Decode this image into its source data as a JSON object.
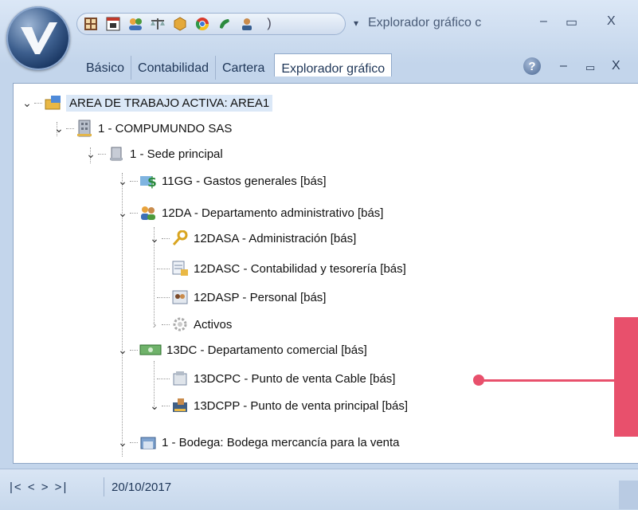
{
  "window": {
    "title": "Explorador gráfico c",
    "controls": {
      "minimize": "–",
      "maximize": "▭",
      "close": "X"
    }
  },
  "ribbon": {
    "tabs": [
      {
        "label": "Básico"
      },
      {
        "label": "Contabilidad"
      },
      {
        "label": "Cartera"
      },
      {
        "label": "Explorador gráfico"
      }
    ],
    "help_label": "?",
    "mdi": {
      "minimize": "–",
      "restore": "▭",
      "close": "X"
    }
  },
  "tree": {
    "nodes": [
      {
        "label": "AREA DE TRABAJO ACTIVA: AREA1",
        "icon": "workspace-icon"
      },
      {
        "label": "1 - COMPUMUNDO SAS",
        "icon": "building-icon"
      },
      {
        "label": "1 - Sede principal",
        "icon": "office-icon"
      },
      {
        "label": "11GG - Gastos generales [bás]",
        "icon": "money-icon"
      },
      {
        "label": "12DA - Departamento administrativo [bás]",
        "icon": "people-icon"
      },
      {
        "label": "12DASA - Administración [bás]",
        "icon": "key-icon"
      },
      {
        "label": "12DASC - Contabilidad y tesorería [bás]",
        "icon": "ledger-icon"
      },
      {
        "label": "12DASP - Personal [bás]",
        "icon": "staff-icon"
      },
      {
        "label": "Activos",
        "icon": "gear-icon"
      },
      {
        "label": "13DC - Departamento comercial [bás]",
        "icon": "cash-icon"
      },
      {
        "label": "13DCPC - Punto de venta Cable [bás]",
        "icon": "register-icon"
      },
      {
        "label": "13DCPP - Punto de venta principal [bás]",
        "icon": "pos-icon"
      },
      {
        "label": "1 - Bodega: Bodega mercancía para la venta",
        "icon": "warehouse-icon"
      }
    ]
  },
  "status": {
    "nav": "|<  <  >  >|",
    "date": "20/10/2017"
  },
  "colors": {
    "accent": "#e8506c",
    "selection": "#dbe8f7"
  }
}
